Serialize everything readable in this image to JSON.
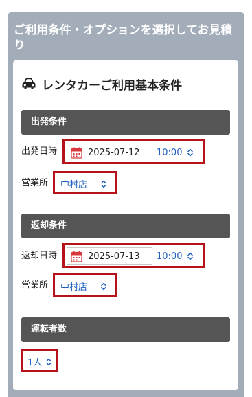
{
  "panel": {
    "title": "ご利用条件・オプションを選択してお見積り"
  },
  "card": {
    "icon": "car-icon",
    "title": "レンタカーご利用基本条件"
  },
  "departure": {
    "section_title": "出発条件",
    "datetime_label": "出発日時",
    "date": "2025-07-12",
    "time": "10:00",
    "office_label": "営業所",
    "office": "中村店"
  },
  "return": {
    "section_title": "返却条件",
    "datetime_label": "返却日時",
    "date": "2025-07-13",
    "time": "10:00",
    "office_label": "営業所",
    "office": "中村店"
  },
  "drivers": {
    "section_title": "運転者数",
    "count": "1人"
  },
  "colors": {
    "panel_bg": "#a3adb9",
    "section_bar": "#555555",
    "highlight_border": "#b5121b",
    "select_text": "#1d5fbf",
    "calendar_icon": "#d9393e"
  }
}
